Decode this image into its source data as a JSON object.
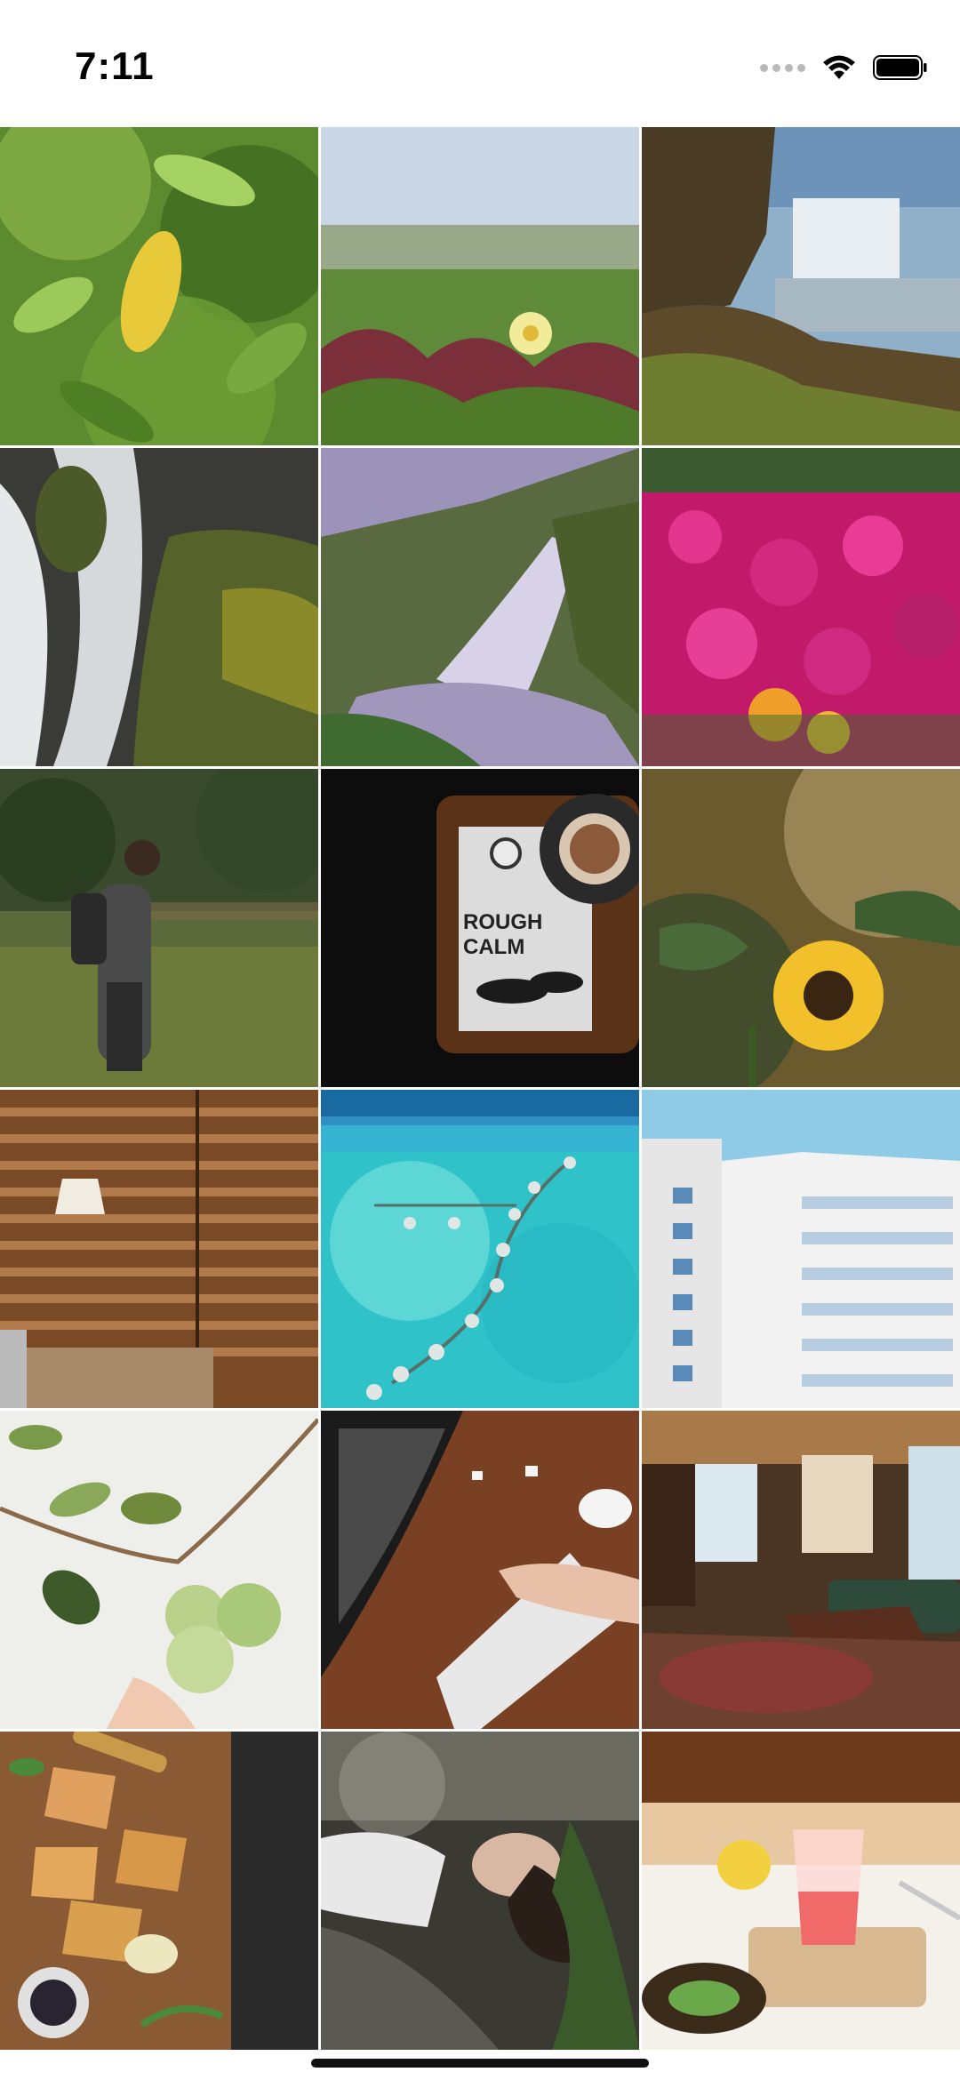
{
  "status_bar": {
    "time": "7:11",
    "icons": [
      "cellular-signal-icon",
      "wifi-icon",
      "battery-icon"
    ]
  },
  "gallery": {
    "photos": [
      {
        "name": "photo-green-leaves"
      },
      {
        "name": "photo-yellow-flower-field"
      },
      {
        "name": "photo-waterfall-coast"
      },
      {
        "name": "photo-waterfall-mossy-rocks"
      },
      {
        "name": "photo-waterfall-valley"
      },
      {
        "name": "photo-pink-flowers"
      },
      {
        "name": "photo-hiker-forest"
      },
      {
        "name": "photo-coffee-watch-book"
      },
      {
        "name": "photo-sunflower"
      },
      {
        "name": "photo-wooden-restaurant"
      },
      {
        "name": "photo-overwater-villas"
      },
      {
        "name": "photo-white-building"
      },
      {
        "name": "photo-green-apples-branch"
      },
      {
        "name": "photo-keyboard-desk"
      },
      {
        "name": "photo-living-room"
      },
      {
        "name": "photo-grilled-sandwiches"
      },
      {
        "name": "photo-woman-lying-ground"
      },
      {
        "name": "photo-pink-drink"
      }
    ]
  },
  "colors": {
    "background": "#ffffff",
    "text": "#000000"
  }
}
